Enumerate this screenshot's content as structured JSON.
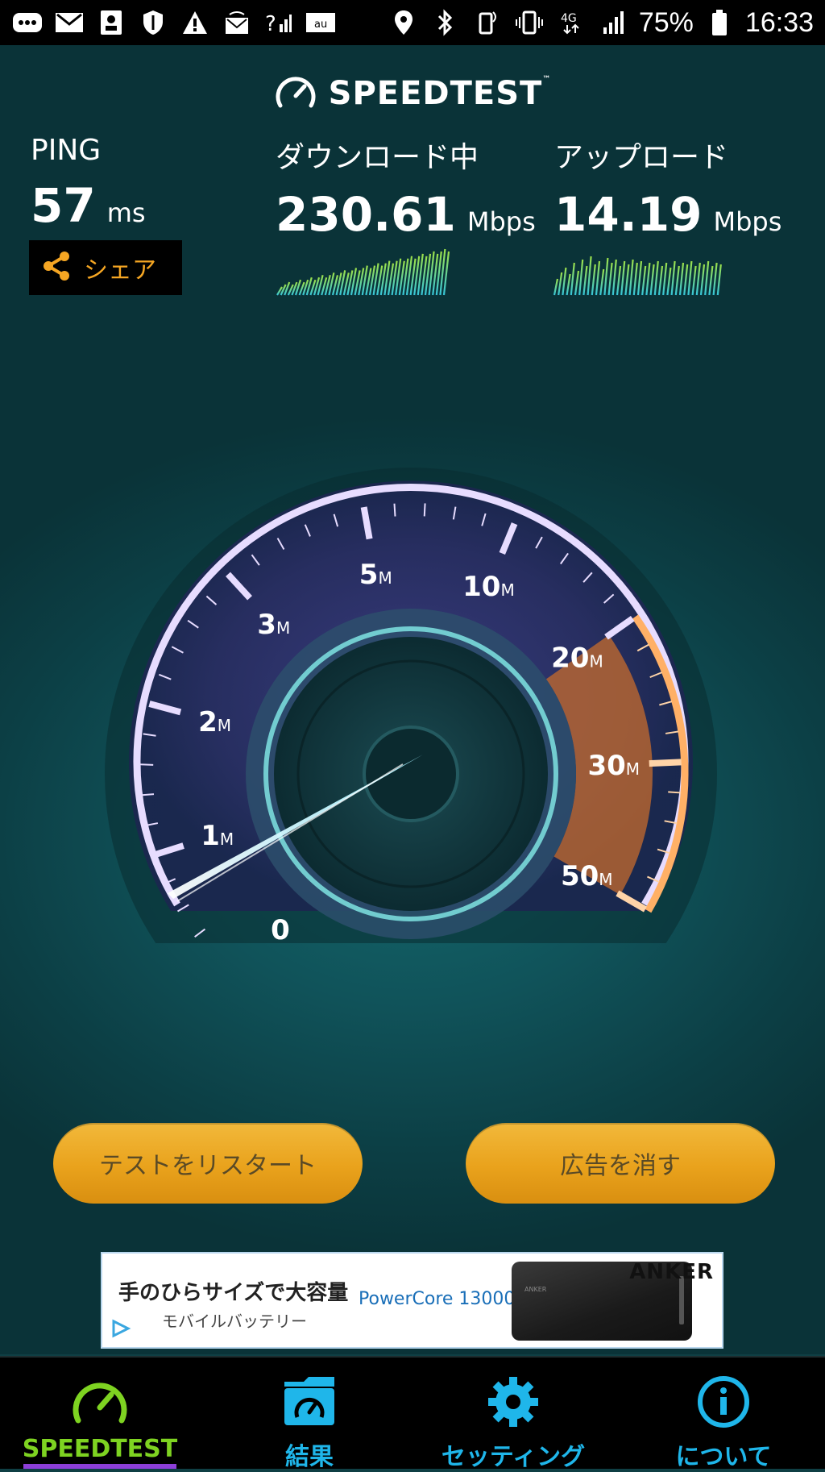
{
  "status_bar": {
    "battery": "75%",
    "time": "16:33",
    "network_label": "4G"
  },
  "header": {
    "app_title": "SPEEDTEST",
    "trademark": "™"
  },
  "metrics": {
    "ping": {
      "label": "PING",
      "value": "57",
      "unit": "ms"
    },
    "download": {
      "label": "ダウンロード中",
      "value": "230.61",
      "unit": "Mbps"
    },
    "upload": {
      "label": "アップロード",
      "value": "14.19",
      "unit": "Mbps"
    }
  },
  "share_label": "シェア",
  "gauge": {
    "ticks": [
      {
        "label": "0",
        "unit": ""
      },
      {
        "label": "1",
        "unit": "M"
      },
      {
        "label": "2",
        "unit": "M"
      },
      {
        "label": "3",
        "unit": "M"
      },
      {
        "label": "5",
        "unit": "M"
      },
      {
        "label": "10",
        "unit": "M"
      },
      {
        "label": "20",
        "unit": "M"
      },
      {
        "label": "30",
        "unit": "M"
      },
      {
        "label": "50",
        "unit": "M"
      }
    ]
  },
  "buttons": {
    "restart": "テストをリスタート",
    "remove_ads": "広告を消す"
  },
  "ad": {
    "headline": "手のひらサイズで大容量",
    "subline": "モバイルバッテリー",
    "product": "PowerCore 13000",
    "brand": "ANKER",
    "device_brand": "ANKER"
  },
  "nav": {
    "items": [
      {
        "label": "SPEEDTEST",
        "color": "#7ed321",
        "icon": "speedometer-icon",
        "active": true
      },
      {
        "label": "結果",
        "color": "#1fb6ea",
        "icon": "results-folder-icon",
        "active": false
      },
      {
        "label": "セッティング",
        "color": "#1fb6ea",
        "icon": "gear-icon",
        "active": false
      },
      {
        "label": "について",
        "color": "#1fb6ea",
        "icon": "info-icon",
        "active": false
      }
    ]
  },
  "colors": {
    "accent_orange": "#f5a623",
    "active_green": "#7ed321",
    "nav_blue": "#1fb6ea",
    "gauge_purple": "#a98cf0"
  }
}
